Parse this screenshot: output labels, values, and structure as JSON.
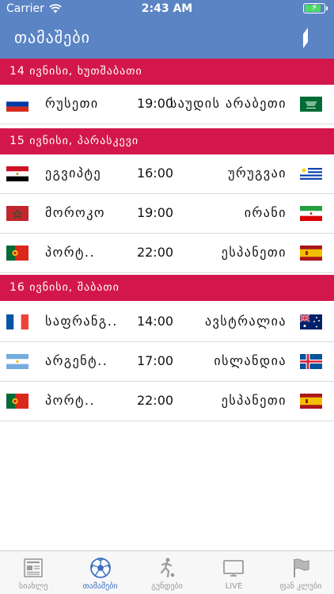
{
  "status_bar": {
    "carrier": "Carrier",
    "time": "2:43 AM",
    "battery_level": 0.85
  },
  "header": {
    "title": "თამაშები",
    "action_icon": "edit-icon"
  },
  "sections": [
    {
      "date": "14 ივნისი, ხუთშაბათი"
    },
    {
      "date": "15 ივნისი, პარასკევი"
    },
    {
      "date": "16 ივნისი, შაბათი"
    }
  ],
  "matches": [
    {
      "home": "რუსეთი",
      "time": "19:00",
      "away": "საუდის არაბეთი",
      "home_flag": "russia-flag",
      "away_flag": "saudi-arabia-flag"
    },
    {
      "home": "ეგვიპტე",
      "time": "16:00",
      "away": "ურუგვაი",
      "home_flag": "egypt-flag",
      "away_flag": "uruguay-flag"
    },
    {
      "home": "მოროკო",
      "time": "19:00",
      "away": "ირანი",
      "home_flag": "morocco-flag",
      "away_flag": "iran-flag"
    },
    {
      "home": "პორტ..",
      "time": "22:00",
      "away": "ესპანეთი",
      "home_flag": "portugal-flag",
      "away_flag": "spain-flag"
    },
    {
      "home": "საფრანგ..",
      "time": "14:00",
      "away": "ავსტრალია",
      "home_flag": "france-flag",
      "away_flag": "australia-flag"
    },
    {
      "home": "არგენტ..",
      "time": "17:00",
      "away": "ისლანდია",
      "home_flag": "argentina-flag",
      "away_flag": "iceland-flag"
    },
    {
      "home": "პორტ..",
      "time": "22:00",
      "away": "ესპანეთი",
      "home_flag": "portugal-flag",
      "away_flag": "spain-flag"
    }
  ],
  "tabs": [
    {
      "label": "სიახლე",
      "icon": "newspaper-icon"
    },
    {
      "label": "თამაშები",
      "icon": "soccer-ball-icon",
      "active": true
    },
    {
      "label": "გუნდები",
      "icon": "player-kick-icon"
    },
    {
      "label": "LIVE",
      "icon": "tv-icon"
    },
    {
      "label": "ფან კლუბი",
      "icon": "flag-icon"
    }
  ],
  "colors": {
    "header_blue": "#5b84c4",
    "section_red": "#d3174a",
    "tab_active": "#3d6fbf",
    "tab_inactive": "#999999"
  }
}
